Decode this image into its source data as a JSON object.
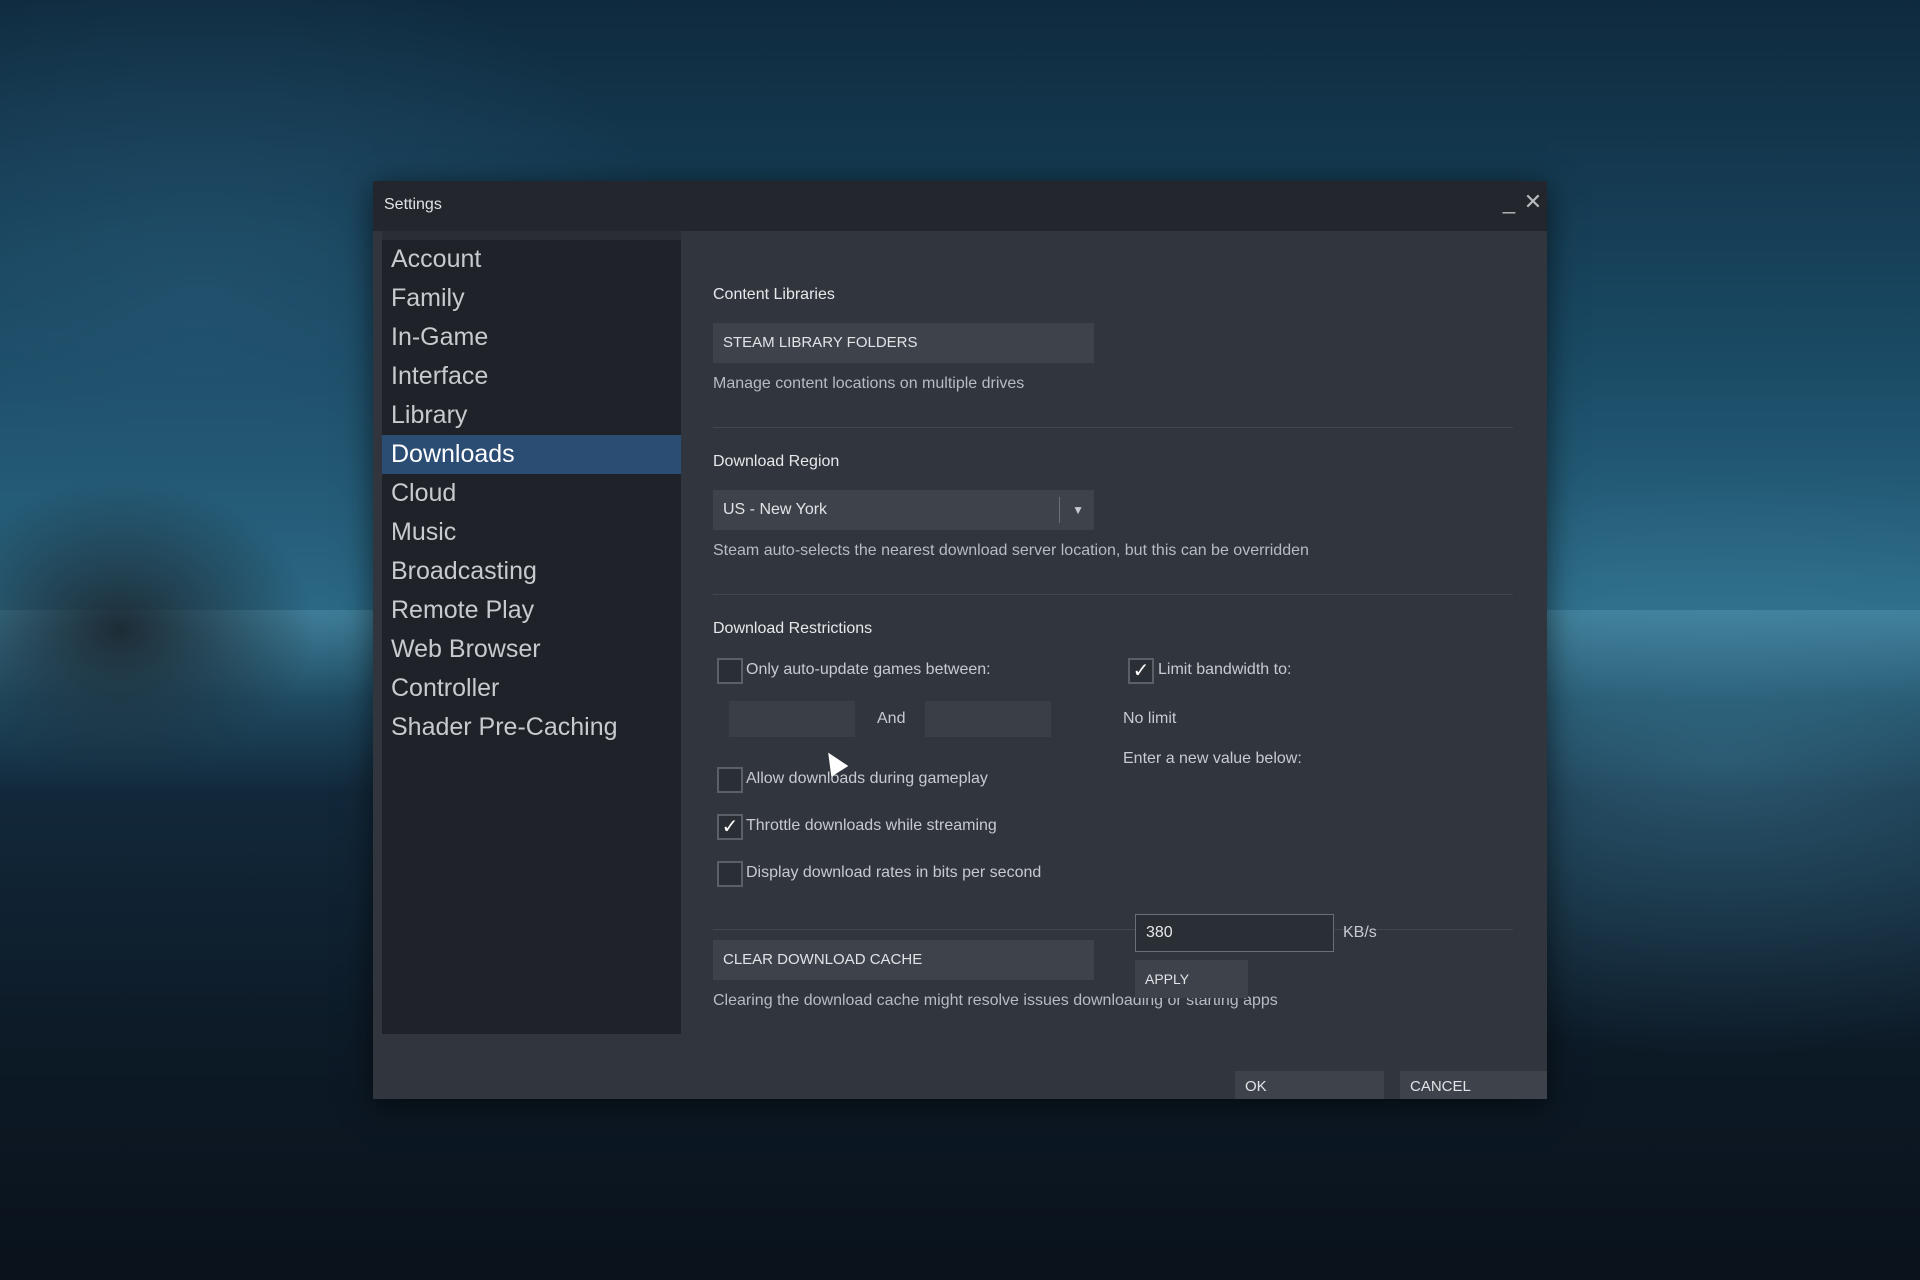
{
  "window": {
    "title": "Settings",
    "minimize_icon": "minimize-icon",
    "close_icon": "close-icon"
  },
  "sidebar": {
    "items": [
      {
        "label": "Account"
      },
      {
        "label": "Family"
      },
      {
        "label": "In-Game"
      },
      {
        "label": "Interface"
      },
      {
        "label": "Library"
      },
      {
        "label": "Downloads",
        "active": true
      },
      {
        "label": "Cloud"
      },
      {
        "label": "Music"
      },
      {
        "label": "Broadcasting"
      },
      {
        "label": "Remote Play"
      },
      {
        "label": "Web Browser"
      },
      {
        "label": "Controller"
      },
      {
        "label": "Shader Pre-Caching"
      }
    ]
  },
  "content_libraries": {
    "title": "Content Libraries",
    "button_label": "STEAM LIBRARY FOLDERS",
    "description": "Manage content locations on multiple drives"
  },
  "download_region": {
    "title": "Download Region",
    "selected": "US - New York",
    "description": "Steam auto-selects the nearest download server location, but this can be overridden"
  },
  "download_restrictions": {
    "title": "Download Restrictions",
    "auto_update": {
      "label": "Only auto-update games between:",
      "checked": false,
      "and_label": "And",
      "start": "",
      "end": ""
    },
    "allow_gameplay": {
      "label": "Allow downloads during gameplay",
      "checked": false
    },
    "throttle": {
      "label": "Throttle downloads while streaming",
      "checked": true
    },
    "bits": {
      "label": "Display download rates in bits per second",
      "checked": false
    },
    "limit_bandwidth": {
      "label": "Limit bandwidth to:",
      "checked": true,
      "current": "No limit",
      "prompt": "Enter a new value below:",
      "value": "380",
      "unit": "KB/s",
      "apply_label": "APPLY"
    }
  },
  "cache": {
    "button_label": "CLEAR DOWNLOAD CACHE",
    "description": "Clearing the download cache might resolve issues downloading or starting apps"
  },
  "footer": {
    "ok_label": "OK",
    "cancel_label": "CANCEL"
  },
  "colors": {
    "accent": "#2b4c73",
    "window_bg": "#31353d",
    "sidebar_bg": "#1f2228"
  }
}
